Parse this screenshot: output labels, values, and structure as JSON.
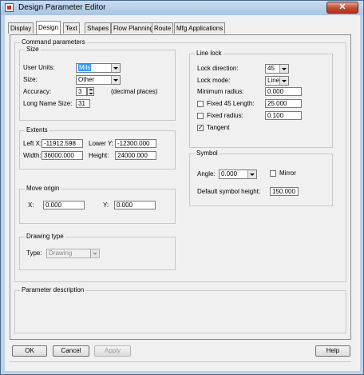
{
  "window": {
    "title": "Design Parameter Editor",
    "close_glyph": "✕"
  },
  "tabs": [
    "Display",
    "Design",
    "Text",
    "Shapes",
    "Flow Planning",
    "Route",
    "Mfg Applications"
  ],
  "active_tab": "Design",
  "command_parameters": {
    "label": "Command parameters"
  },
  "size": {
    "label": "Size",
    "user_units_label": "User Units:",
    "user_units_value": "Mils",
    "size_label": "Size:",
    "size_value": "Other",
    "accuracy_label": "Accuracy:",
    "accuracy_value": "3",
    "accuracy_note": "(decimal places)",
    "long_name_label": "Long Name Size:",
    "long_name_value": "31"
  },
  "extents": {
    "label": "Extents",
    "left_x_label": "Left X:",
    "left_x_value": "-11912.598",
    "lower_y_label": "Lower Y:",
    "lower_y_value": "-12300.000",
    "width_label": "Width:",
    "width_value": "36000.000",
    "height_label": "Height:",
    "height_value": "24000.000"
  },
  "move_origin": {
    "label": "Move origin",
    "x_label": "X:",
    "x_value": "0.000",
    "y_label": "Y:",
    "y_value": "0.000"
  },
  "drawing_type": {
    "label": "Drawing type",
    "type_label": "Type:",
    "type_value": "Drawing"
  },
  "line_lock": {
    "label": "Line lock",
    "lock_direction_label": "Lock direction:",
    "lock_direction_value": "45",
    "lock_mode_label": "Lock mode:",
    "lock_mode_value": "Line",
    "minimum_radius_label": "Minimum radius:",
    "minimum_radius_value": "0.000",
    "fixed45_label": "Fixed 45 Length:",
    "fixed45_value": "25.000",
    "fixed45_checked": false,
    "fixed_radius_label": "Fixed radius:",
    "fixed_radius_value": "0.100",
    "fixed_radius_checked": false,
    "tangent_label": "Tangent",
    "tangent_checked": true,
    "check_mark": "✓"
  },
  "symbol": {
    "label": "Symbol",
    "angle_label": "Angle:",
    "angle_value": "0.000",
    "mirror_label": "Mirror",
    "mirror_checked": false,
    "default_height_label": "Default symbol height:",
    "default_height_value": "150.000"
  },
  "parameter_description": {
    "label": "Parameter description"
  },
  "buttons": {
    "ok": "OK",
    "cancel": "Cancel",
    "apply": "Apply",
    "help": "Help"
  }
}
